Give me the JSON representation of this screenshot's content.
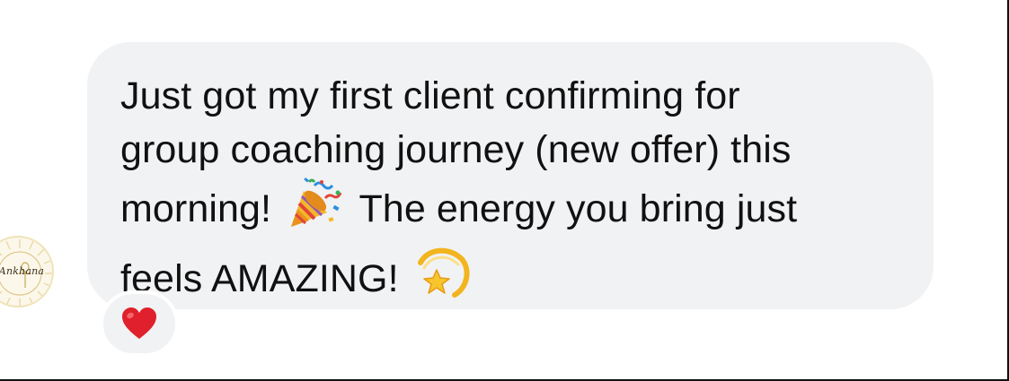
{
  "message": {
    "line1": "Just got my first client confirming for",
    "line2": "group coaching journey (new offer) this",
    "line3_before_emoji": "morning!",
    "line3_after_emoji": "The energy you bring just",
    "line4": "feels AMAZING!"
  },
  "emojis": {
    "first": "party-popper-icon",
    "second": "dizzy-star-icon"
  },
  "reaction": {
    "icon": "red-heart-icon",
    "color": "#e0202c"
  },
  "avatar": {
    "logo_text": "Ankhana"
  },
  "colors": {
    "bubble": "#f1f2f4",
    "text": "#111111",
    "background": "#ffffff"
  }
}
